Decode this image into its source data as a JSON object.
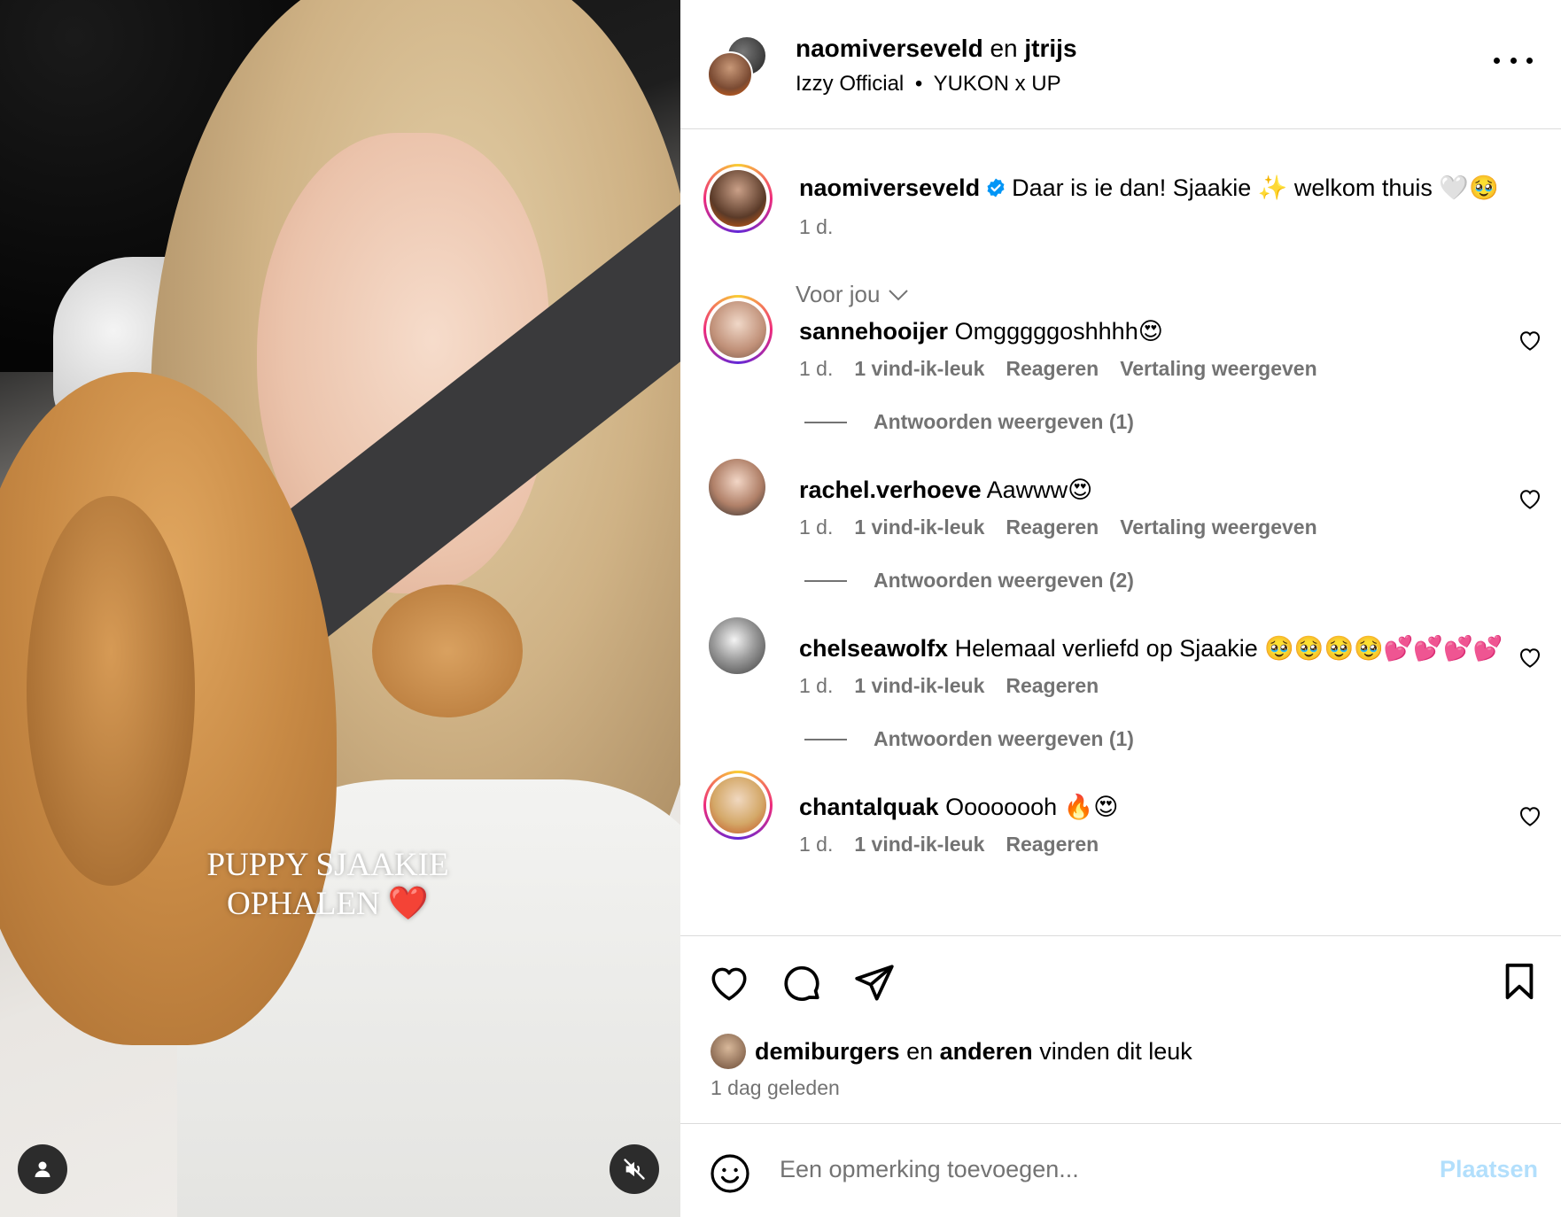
{
  "media": {
    "overlay_line1": "PUPPY SJAAKIE",
    "overlay_line2": "OPHALEN ❤️",
    "user_icon": "user-icon",
    "mute_icon": "muted-speaker-icon"
  },
  "header": {
    "author1": "naomiverseveld",
    "joiner": "en",
    "author2": "jtrijs",
    "audio_artist": "Izzy Official",
    "separator": "•",
    "audio_title": "YUKON x UP"
  },
  "caption": {
    "username": "naomiverseveld",
    "text": "Daar is ie dan! Sjaakie ✨ welkom thuis 🤍🥹",
    "age": "1 d."
  },
  "filter": {
    "label": "Voor jou"
  },
  "comments": [
    {
      "username": "sannehooijer",
      "text": "Omgggggoshhhh😍",
      "age": "1 d.",
      "likes": "1 vind-ik-leuk",
      "reply": "Reageren",
      "translate": "Vertaling weergeven",
      "replies": "Antwoorden weergeven (1)"
    },
    {
      "username": "rachel.verhoeve",
      "text": "Aawww😍",
      "age": "1 d.",
      "likes": "1 vind-ik-leuk",
      "reply": "Reageren",
      "translate": "Vertaling weergeven",
      "replies": "Antwoorden weergeven (2)"
    },
    {
      "username": "chelseawolfx",
      "text": "Helemaal verliefd op Sjaakie 🥹🥹🥹🥹💕💕💕💕",
      "age": "1 d.",
      "likes": "1 vind-ik-leuk",
      "reply": "Reageren",
      "replies": "Antwoorden weergeven (1)"
    },
    {
      "username": "chantalquak",
      "text": "Oooooooh 🔥😍",
      "age": "1 d.",
      "likes": "1 vind-ik-leuk",
      "reply": "Reageren"
    }
  ],
  "actions": {
    "liked_by_user": "demiburgers",
    "liked_joiner": "en",
    "liked_others": "anderen",
    "liked_suffix": "vinden dit leuk",
    "date": "1 dag geleden"
  },
  "composer": {
    "placeholder": "Een opmerking toevoegen...",
    "post_label": "Plaatsen"
  },
  "colors": {
    "muted_text": "#737373",
    "post_disabled": "#b2dffc",
    "verified_blue": "#0095f6",
    "divider": "#dbdbdb"
  }
}
